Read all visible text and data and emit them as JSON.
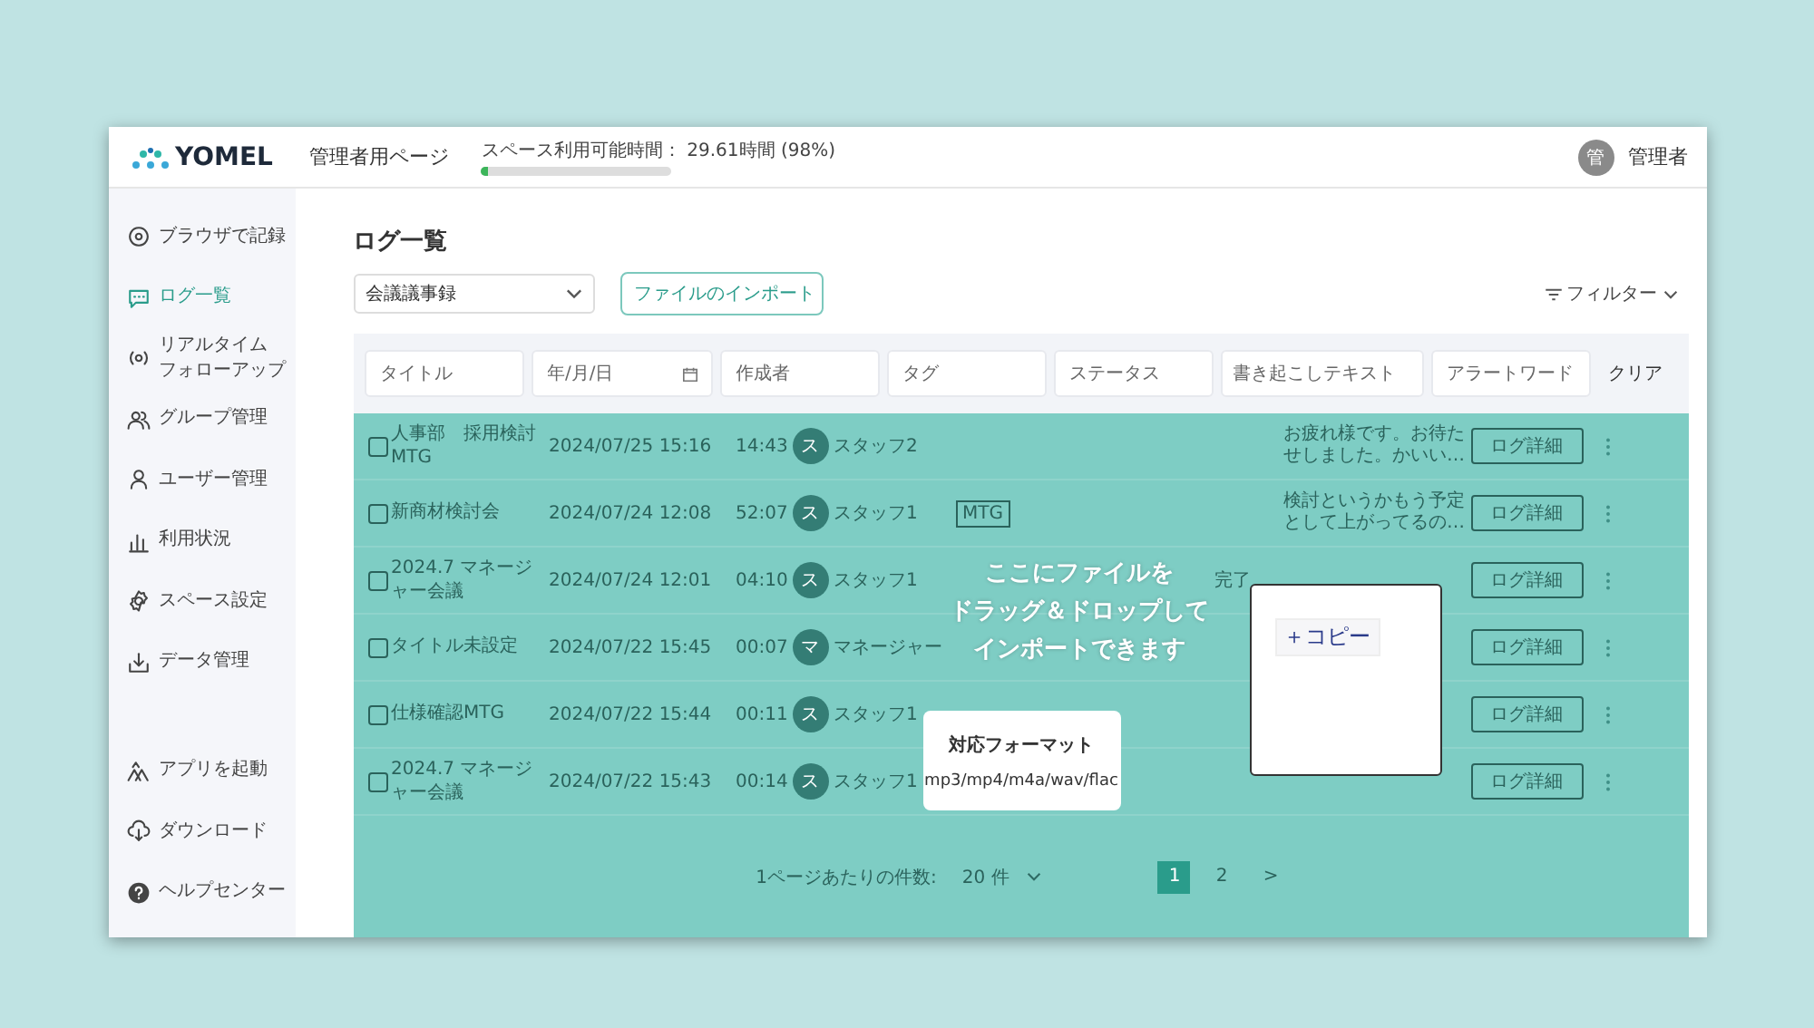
{
  "header": {
    "logo": "YOMEL",
    "page_label": "管理者用ページ",
    "storage": {
      "label": "スペース利用可能時間： 29.61時間 (98%)",
      "level": 0.03
    },
    "user_initial": "管",
    "user_name": "管理者"
  },
  "sidebar": {
    "items": [
      {
        "lines": [
          "ブラウザで記録"
        ],
        "selected": false
      },
      {
        "lines": [
          "ログ一覧"
        ],
        "selected": true
      },
      {
        "lines": [
          "リアルタイム",
          "フォローアップ"
        ],
        "selected": false
      },
      {
        "lines": [
          "グループ管理"
        ],
        "selected": false
      },
      {
        "lines": [
          "ユーザー管理"
        ],
        "selected": false
      },
      {
        "lines": [
          "利用状況"
        ],
        "selected": false
      },
      {
        "lines": [
          "スペース設定"
        ],
        "selected": false
      },
      {
        "lines": [
          "データ管理"
        ],
        "selected": false
      }
    ],
    "bottom_items": [
      {
        "label": "アプリを起動"
      },
      {
        "label": "ダウンロード"
      },
      {
        "label": "ヘルプセンター"
      }
    ]
  },
  "main": {
    "title": "ログ一覧",
    "type_select": "会議議事録",
    "import_button": "ファイルのインポート",
    "filter_button": "フィルター",
    "filters": [
      {
        "placeholder": "タイトル",
        "kind": "text"
      },
      {
        "placeholder": "年/月/日",
        "kind": "date"
      },
      {
        "placeholder": "作成者",
        "kind": "text"
      },
      {
        "placeholder": "タグ",
        "kind": "text"
      },
      {
        "placeholder": "ステータス",
        "kind": "text"
      },
      {
        "placeholder": "書き起こしテキスト",
        "kind": "wide"
      },
      {
        "placeholder": "アラートワード",
        "kind": "text"
      }
    ],
    "clear_button": "クリア"
  },
  "table": {
    "rows": [
      {
        "checked": false,
        "title": "人事部　採用検討MTG",
        "date": "2024/07/25 15:16",
        "duration": "14:43",
        "initial": "ス",
        "author": "スタッフ2",
        "tag": "",
        "status": "",
        "text": "お疲れ様です。お待たせしました。かいい…",
        "button": "ログ詳細"
      },
      {
        "checked": false,
        "title": "新商材検討会",
        "date": "2024/07/24 12:08",
        "duration": "52:07",
        "initial": "ス",
        "author": "スタッフ1",
        "tag": "MTG",
        "status": "",
        "text": "検討というかもう予定として上がってるの…",
        "button": "ログ詳細"
      },
      {
        "checked": false,
        "title": "2024.7 マネージャー会議",
        "date": "2024/07/24 12:01",
        "duration": "04:10",
        "initial": "ス",
        "author": "スタッフ1",
        "tag": "",
        "status": "完了",
        "text": "",
        "button": "ログ詳細"
      },
      {
        "checked": false,
        "title": "タイトル未設定",
        "date": "2024/07/22 15:45",
        "duration": "00:07",
        "initial": "マ",
        "author": "マネージャー",
        "tag": "",
        "status": "",
        "text": "",
        "button": "ログ詳細"
      },
      {
        "checked": false,
        "title": "仕様確認MTG",
        "date": "2024/07/22 15:44",
        "duration": "00:11",
        "initial": "ス",
        "author": "スタッフ1",
        "tag": "",
        "status": "",
        "text": "",
        "button": "ログ詳細"
      },
      {
        "checked": false,
        "title": "2024.7 マネージャー会議",
        "date": "2024/07/22 15:43",
        "duration": "00:14",
        "initial": "ス",
        "author": "スタッフ1",
        "tag": "",
        "status": "",
        "text": "",
        "button": "ログ詳細"
      }
    ],
    "per_page_label": "1ページあたりの件数:",
    "per_page_value": "20 件",
    "pages": [
      {
        "label": "1",
        "selected": true
      },
      {
        "label": "2",
        "selected": false
      },
      {
        "label": ">",
        "selected": false
      }
    ]
  },
  "drop_overlay": {
    "lines": [
      "ここにファイルを",
      "ドラッグ＆ドロップして",
      "インポートできます"
    ],
    "format_title": "対応フォーマット",
    "formats": "mp3/mp4/m4a/wav/flac"
  },
  "context_menu": {
    "item": "＋コピー"
  }
}
